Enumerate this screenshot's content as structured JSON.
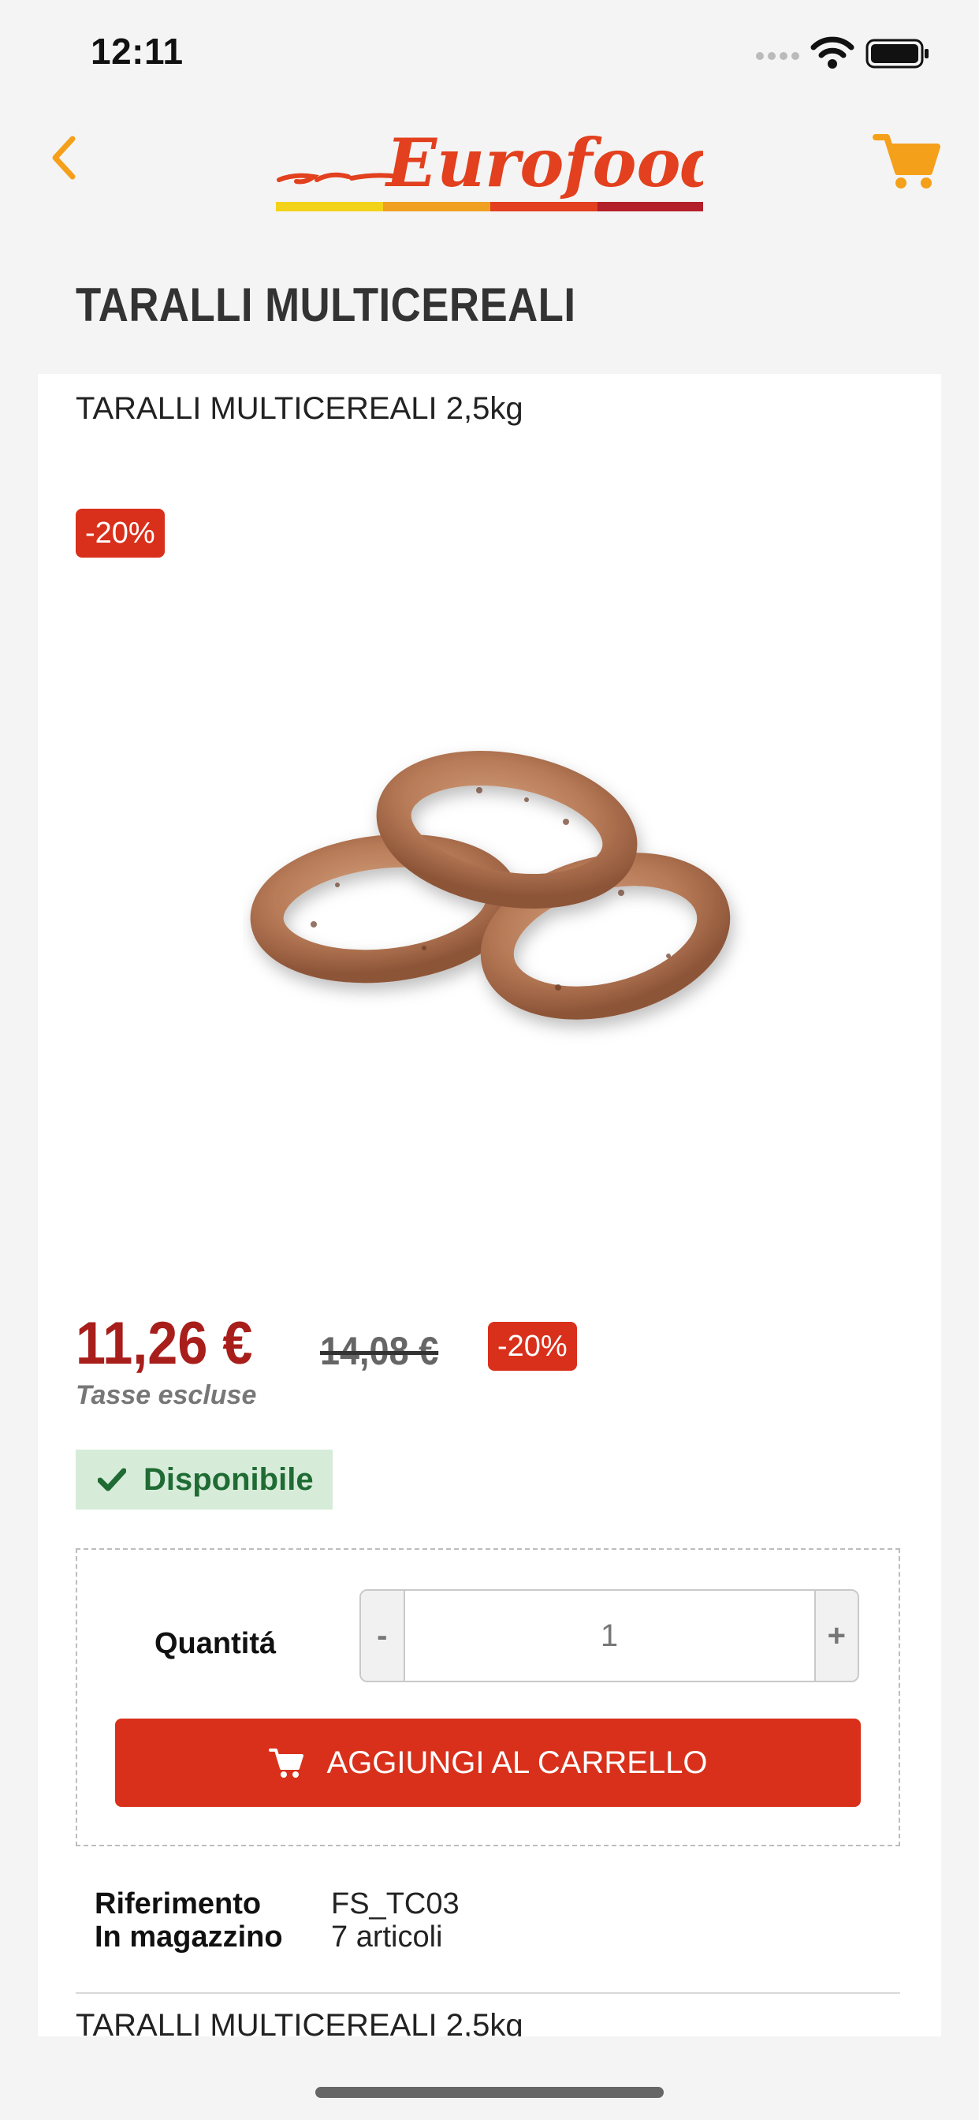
{
  "status_bar": {
    "time": "12:11",
    "icons": [
      "signal-dots-icon",
      "wifi-icon",
      "battery-icon"
    ]
  },
  "nav": {
    "back_icon": "chevron-left-icon",
    "logo_text": "Eurofood",
    "cart_icon": "cart-icon",
    "logo_stripe_colors": [
      "#f3d31a",
      "#f0a020",
      "#e2401e",
      "#b3202a"
    ]
  },
  "product": {
    "title": "TARALLI MULTICEREALI",
    "subtitle": "TARALLI MULTICEREALI 2,5kg",
    "discount_badge": "-20%",
    "price_current": "11,26 €",
    "price_old": "14,08 €",
    "tax_note": "Tasse escluse",
    "availability": "Disponibile"
  },
  "buy_box": {
    "quantity_label": "Quantitá",
    "minus_label": "-",
    "quantity_value": "1",
    "plus_label": "+",
    "add_to_cart_label": "AGGIUNGI AL CARRELLO"
  },
  "details": {
    "reference_label": "Riferimento",
    "reference_value": "FS_TC03",
    "stock_label": "In magazzino",
    "stock_value": "7 articoli"
  },
  "cut_off_text": "TARALLI MULTICEREALI 2,5kg",
  "colors": {
    "accent_orange": "#f5a01a",
    "discount_red": "#d9301b",
    "price_red": "#a81e1b",
    "available_green_bg": "#d6ecd9",
    "available_green_text": "#1f6b33"
  }
}
